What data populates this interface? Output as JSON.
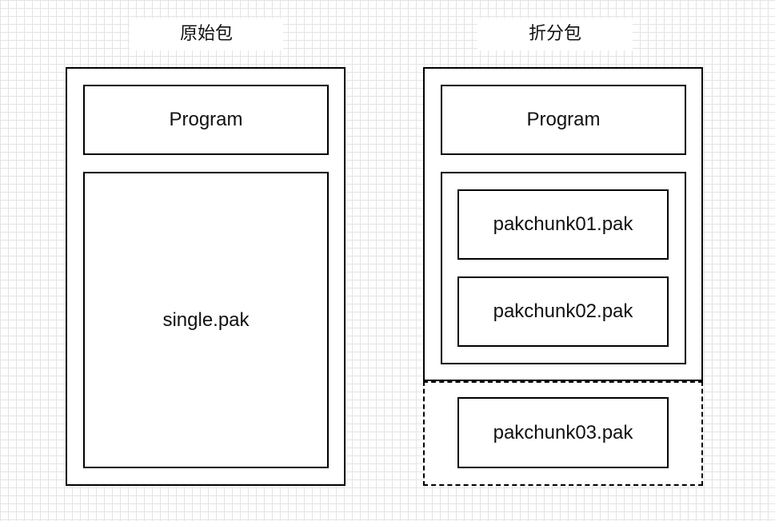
{
  "original": {
    "title": "原始包",
    "program_label": "Program",
    "pak_label": "single.pak"
  },
  "split": {
    "title": "折分包",
    "program_label": "Program",
    "chunks": [
      {
        "label": "pakchunk01.pak"
      },
      {
        "label": "pakchunk02.pak"
      },
      {
        "label": "pakchunk03.pak"
      }
    ]
  }
}
